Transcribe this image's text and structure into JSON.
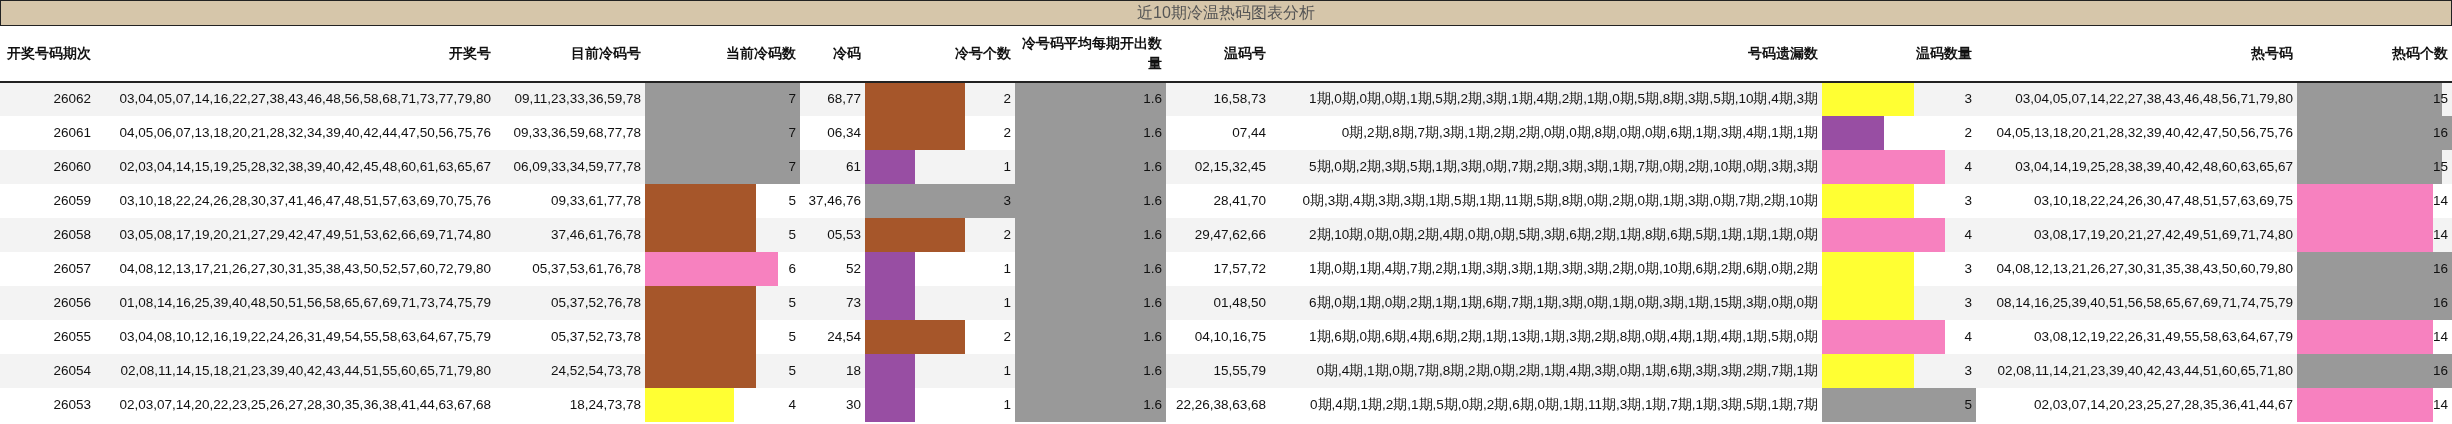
{
  "title": "近10期冷温热码图表分析",
  "columns": [
    "开奖号码期次",
    "开奖号",
    "目前冷码号",
    "当前冷码数",
    "冷码",
    "冷号个数",
    "冷号码平均每期开出数量",
    "温码号",
    "号码遗漏数",
    "温码数量",
    "热号码",
    "热码个数"
  ],
  "rows": [
    {
      "period": "26062",
      "numbers": "03,04,05,07,14,16,22,27,38,43,46,48,56,58,68,71,73,77,79,80",
      "cold_numbers": "09,11,23,33,36,59,78",
      "cold_count": {
        "value": "7",
        "level": 1,
        "color": "#999999"
      },
      "cold_codes": "68,77",
      "cold_code_count": {
        "value": "2",
        "level": 0.667,
        "color": "#a6562a"
      },
      "average": {
        "value": "1.6",
        "level": 1,
        "color": "#999999"
      },
      "warm_numbers": "16,58,73",
      "omission": "1期,0期,0期,0期,1期,5期,2期,3期,1期,4期,2期,1期,0期,5期,8期,3期,5期,10期,4期,3期",
      "warm_count": {
        "value": "3",
        "level": 0.6,
        "color": "#ffff33"
      },
      "hot_numbers": "03,04,05,07,14,22,27,38,43,46,48,56,71,79,80",
      "hot_count": {
        "value": "15",
        "level": 0.9375,
        "color": "#999999"
      }
    },
    {
      "period": "26061",
      "numbers": "04,05,06,07,13,18,20,21,28,32,34,39,40,42,44,47,50,56,75,76",
      "cold_numbers": "09,33,36,59,68,77,78",
      "cold_count": {
        "value": "7",
        "level": 1,
        "color": "#999999"
      },
      "cold_codes": "06,34",
      "cold_code_count": {
        "value": "2",
        "level": 0.667,
        "color": "#a6562a"
      },
      "average": {
        "value": "1.6",
        "level": 1,
        "color": "#999999"
      },
      "warm_numbers": "07,44",
      "omission": "0期,2期,8期,7期,3期,1期,2期,2期,0期,0期,8期,0期,0期,6期,1期,3期,4期,1期,1期",
      "warm_count": {
        "value": "2",
        "level": 0.4,
        "color": "#984ea3"
      },
      "hot_numbers": "04,05,13,18,20,21,28,32,39,40,42,47,50,56,75,76",
      "hot_count": {
        "value": "16",
        "level": 1,
        "color": "#999999"
      }
    },
    {
      "period": "26060",
      "numbers": "02,03,04,14,15,19,25,28,32,38,39,40,42,45,48,60,61,63,65,67",
      "cold_numbers": "06,09,33,34,59,77,78",
      "cold_count": {
        "value": "7",
        "level": 1,
        "color": "#999999"
      },
      "cold_codes": "61",
      "cold_code_count": {
        "value": "1",
        "level": 0.333,
        "color": "#984ea3"
      },
      "average": {
        "value": "1.6",
        "level": 1,
        "color": "#999999"
      },
      "warm_numbers": "02,15,32,45",
      "omission": "5期,0期,2期,3期,5期,1期,3期,0期,7期,2期,3期,3期,1期,7期,0期,2期,10期,0期,3期,3期",
      "warm_count": {
        "value": "4",
        "level": 0.8,
        "color": "#f781bf"
      },
      "hot_numbers": "03,04,14,19,25,28,38,39,40,42,48,60,63,65,67",
      "hot_count": {
        "value": "15",
        "level": 0.9375,
        "color": "#999999"
      }
    },
    {
      "period": "26059",
      "numbers": "03,10,18,22,24,26,28,30,37,41,46,47,48,51,57,63,69,70,75,76",
      "cold_numbers": "09,33,61,77,78",
      "cold_count": {
        "value": "5",
        "level": 0.714,
        "color": "#a6562a"
      },
      "cold_codes": "37,46,76",
      "cold_code_count": {
        "value": "3",
        "level": 1,
        "color": "#999999"
      },
      "average": {
        "value": "1.6",
        "level": 1,
        "color": "#999999"
      },
      "warm_numbers": "28,41,70",
      "omission": "0期,3期,4期,3期,3期,1期,5期,1期,11期,5期,8期,0期,2期,0期,1期,3期,0期,7期,2期,10期",
      "warm_count": {
        "value": "3",
        "level": 0.6,
        "color": "#ffff33"
      },
      "hot_numbers": "03,10,18,22,24,26,30,47,48,51,57,63,69,75",
      "hot_count": {
        "value": "14",
        "level": 0.875,
        "color": "#f781bf"
      }
    },
    {
      "period": "26058",
      "numbers": "03,05,08,17,19,20,21,27,29,42,47,49,51,53,62,66,69,71,74,80",
      "cold_numbers": "37,46,61,76,78",
      "cold_count": {
        "value": "5",
        "level": 0.714,
        "color": "#a6562a"
      },
      "cold_codes": "05,53",
      "cold_code_count": {
        "value": "2",
        "level": 0.667,
        "color": "#a6562a"
      },
      "average": {
        "value": "1.6",
        "level": 1,
        "color": "#999999"
      },
      "warm_numbers": "29,47,62,66",
      "omission": "2期,10期,0期,0期,2期,4期,0期,0期,5期,3期,6期,2期,1期,8期,6期,5期,1期,1期,1期,0期",
      "warm_count": {
        "value": "4",
        "level": 0.8,
        "color": "#f781bf"
      },
      "hot_numbers": "03,08,17,19,20,21,27,42,49,51,69,71,74,80",
      "hot_count": {
        "value": "14",
        "level": 0.875,
        "color": "#f781bf"
      }
    },
    {
      "period": "26057",
      "numbers": "04,08,12,13,17,21,26,27,30,31,35,38,43,50,52,57,60,72,79,80",
      "cold_numbers": "05,37,53,61,76,78",
      "cold_count": {
        "value": "6",
        "level": 0.857,
        "color": "#f781bf"
      },
      "cold_codes": "52",
      "cold_code_count": {
        "value": "1",
        "level": 0.333,
        "color": "#984ea3"
      },
      "average": {
        "value": "1.6",
        "level": 1,
        "color": "#999999"
      },
      "warm_numbers": "17,57,72",
      "omission": "1期,0期,1期,4期,7期,2期,1期,3期,3期,1期,3期,3期,2期,0期,10期,6期,2期,6期,0期,2期",
      "warm_count": {
        "value": "3",
        "level": 0.6,
        "color": "#ffff33"
      },
      "hot_numbers": "04,08,12,13,21,26,27,30,31,35,38,43,50,60,79,80",
      "hot_count": {
        "value": "16",
        "level": 1,
        "color": "#999999"
      }
    },
    {
      "period": "26056",
      "numbers": "01,08,14,16,25,39,40,48,50,51,56,58,65,67,69,71,73,74,75,79",
      "cold_numbers": "05,37,52,76,78",
      "cold_count": {
        "value": "5",
        "level": 0.714,
        "color": "#a6562a"
      },
      "cold_codes": "73",
      "cold_code_count": {
        "value": "1",
        "level": 0.333,
        "color": "#984ea3"
      },
      "average": {
        "value": "1.6",
        "level": 1,
        "color": "#999999"
      },
      "warm_numbers": "01,48,50",
      "omission": "6期,0期,1期,0期,2期,1期,1期,6期,7期,1期,3期,0期,1期,0期,3期,1期,15期,3期,0期,0期",
      "warm_count": {
        "value": "3",
        "level": 0.6,
        "color": "#ffff33"
      },
      "hot_numbers": "08,14,16,25,39,40,51,56,58,65,67,69,71,74,75,79",
      "hot_count": {
        "value": "16",
        "level": 1,
        "color": "#999999"
      }
    },
    {
      "period": "26055",
      "numbers": "03,04,08,10,12,16,19,22,24,26,31,49,54,55,58,63,64,67,75,79",
      "cold_numbers": "05,37,52,73,78",
      "cold_count": {
        "value": "5",
        "level": 0.714,
        "color": "#a6562a"
      },
      "cold_codes": "24,54",
      "cold_code_count": {
        "value": "2",
        "level": 0.667,
        "color": "#a6562a"
      },
      "average": {
        "value": "1.6",
        "level": 1,
        "color": "#999999"
      },
      "warm_numbers": "04,10,16,75",
      "omission": "1期,6期,0期,6期,4期,6期,2期,1期,13期,1期,3期,2期,8期,0期,4期,1期,4期,1期,5期,0期",
      "warm_count": {
        "value": "4",
        "level": 0.8,
        "color": "#f781bf"
      },
      "hot_numbers": "03,08,12,19,22,26,31,49,55,58,63,64,67,79",
      "hot_count": {
        "value": "14",
        "level": 0.875,
        "color": "#f781bf"
      }
    },
    {
      "period": "26054",
      "numbers": "02,08,11,14,15,18,21,23,39,40,42,43,44,51,55,60,65,71,79,80",
      "cold_numbers": "24,52,54,73,78",
      "cold_count": {
        "value": "5",
        "level": 0.714,
        "color": "#a6562a"
      },
      "cold_codes": "18",
      "cold_code_count": {
        "value": "1",
        "level": 0.333,
        "color": "#984ea3"
      },
      "average": {
        "value": "1.6",
        "level": 1,
        "color": "#999999"
      },
      "warm_numbers": "15,55,79",
      "omission": "0期,4期,1期,0期,7期,8期,2期,0期,2期,1期,4期,3期,0期,1期,6期,3期,3期,2期,7期,1期",
      "warm_count": {
        "value": "3",
        "level": 0.6,
        "color": "#ffff33"
      },
      "hot_numbers": "02,08,11,14,21,23,39,40,42,43,44,51,60,65,71,80",
      "hot_count": {
        "value": "16",
        "level": 1,
        "color": "#999999"
      }
    },
    {
      "period": "26053",
      "numbers": "02,03,07,14,20,22,23,25,26,27,28,30,35,36,38,41,44,63,67,68",
      "cold_numbers": "18,24,73,78",
      "cold_count": {
        "value": "4",
        "level": 0.571,
        "color": "#ffff33"
      },
      "cold_codes": "30",
      "cold_code_count": {
        "value": "1",
        "level": 0.333,
        "color": "#984ea3"
      },
      "average": {
        "value": "1.6",
        "level": 1,
        "color": "#999999"
      },
      "warm_numbers": "22,26,38,63,68",
      "omission": "0期,4期,1期,2期,1期,5期,0期,2期,6期,0期,1期,11期,3期,1期,7期,1期,3期,5期,1期,7期",
      "warm_count": {
        "value": "5",
        "level": 1,
        "color": "#999999"
      },
      "hot_numbers": "02,03,07,14,20,23,25,27,28,35,36,41,44,67",
      "hot_count": {
        "value": "14",
        "level": 0.875,
        "color": "#f781bf"
      }
    }
  ]
}
